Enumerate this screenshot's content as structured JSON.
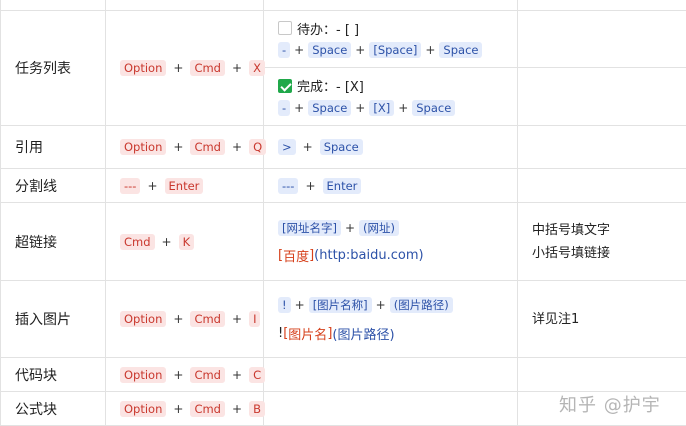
{
  "rows": {
    "task_list": {
      "name": "任务列表",
      "keys": [
        "Option",
        "Cmd",
        "X"
      ],
      "todo": {
        "label": "待办：- [ ]",
        "syntax": [
          "-",
          "Space",
          "[Space]",
          "Space"
        ]
      },
      "done": {
        "label": "完成：- [X]",
        "syntax": [
          "-",
          "Space",
          "[X]",
          "Space"
        ]
      }
    },
    "quote": {
      "name": "引用",
      "keys": [
        "Option",
        "Cmd",
        "Q"
      ],
      "syntax": [
        ">",
        "Space"
      ]
    },
    "divider": {
      "name": "分割线",
      "keys": [
        "---",
        "Enter"
      ],
      "syntax": [
        "---",
        "Enter"
      ]
    },
    "link": {
      "name": "超链接",
      "keys": [
        "Cmd",
        "K"
      ],
      "syntax": [
        "[网址名字]",
        "(网址)"
      ],
      "example": {
        "open": "[",
        "text": "百度",
        "close": "]",
        "url": "(http:baidu.com)"
      },
      "notes": [
        "中括号填文字",
        "小括号填链接"
      ]
    },
    "image": {
      "name": "插入图片",
      "keys": [
        "Option",
        "Cmd",
        "I"
      ],
      "syntax": [
        "!",
        "[图片名称]",
        "(图片路径)"
      ],
      "example": {
        "bang": "!",
        "open": "[",
        "text": "图片名",
        "close": "]",
        "path": "(图片路径)"
      },
      "note": "详见注1"
    },
    "code_block": {
      "name": "代码块",
      "keys": [
        "Option",
        "Cmd",
        "C"
      ]
    },
    "formula_block": {
      "name": "公式块",
      "keys": [
        "Option",
        "Cmd",
        "B"
      ]
    }
  },
  "plus_sign": "+",
  "watermark": "知乎 @护宇"
}
